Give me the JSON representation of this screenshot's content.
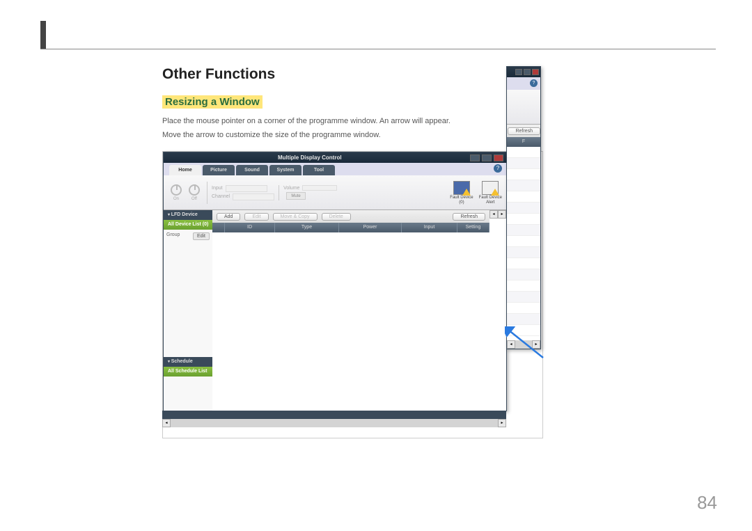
{
  "heading": "Other Functions",
  "subheading": "Resizing a Window",
  "para1": "Place the mouse pointer on a corner of the programme window. An arrow will appear.",
  "para2": "Move the arrow to customize the size of the programme window.",
  "page_number": "84",
  "app": {
    "title": "Multiple Display Control",
    "tabs": {
      "t1": "Home",
      "t2": "Picture",
      "t3": "Sound",
      "t4": "System",
      "t5": "Tool"
    },
    "help": "?",
    "power": {
      "on": "On",
      "off": "Off"
    },
    "ctrl": {
      "input": "Input",
      "channel": "Channel",
      "volume": "Volume",
      "mute": "Mute"
    },
    "fault": {
      "dev": "Fault Device",
      "devn": "(0)",
      "alert": "Fault Device",
      "alert2": "Alert"
    },
    "sidebar": {
      "hdr1": "LFD Device",
      "sel1": "All Device List (0)",
      "group": "Group",
      "edit": "Edit",
      "hdr2": "Schedule",
      "sel2": "All Schedule List"
    },
    "actions": {
      "add": "Add",
      "edit": "Edit",
      "move": "Move & Copy",
      "delete": "Delete",
      "refresh": "Refresh"
    },
    "cols": {
      "c1": "",
      "c2": "ID",
      "c3": "Type",
      "c4": "Power",
      "c5": "Input",
      "c6": "Setting",
      "c7": "F"
    }
  }
}
